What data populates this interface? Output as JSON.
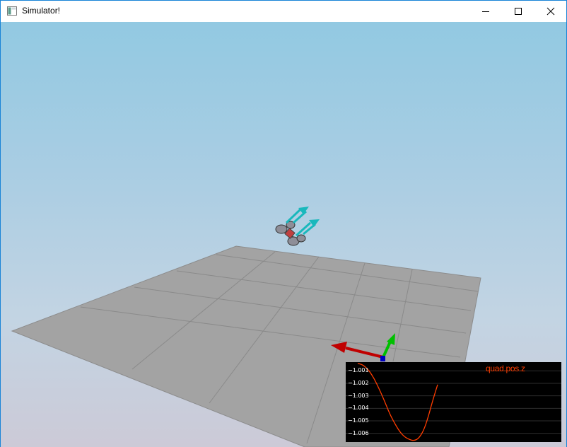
{
  "window": {
    "title": "Simulator!",
    "icons": {
      "app": "window-app-icon",
      "minimize": "minimize-icon",
      "maximize": "maximize-icon",
      "close": "close-icon"
    }
  },
  "scene": {
    "colors": {
      "sky_top": "#92c9e2",
      "sky_bottom": "#cccad7",
      "floor": "#a3a3a3",
      "floor_lines": "#8a8a8a",
      "thrust_arrows": "#19b8bc",
      "axis_x": "#c00000",
      "axis_y": "#00c000",
      "axis_z": "#0000c0"
    }
  },
  "plot": {
    "title": "quad.pos.z",
    "yticks": [
      "-1.001",
      "-1.002",
      "-1.003",
      "-1.004",
      "-1.005",
      "-1.006"
    ],
    "line_color": "#ff3d00",
    "chart_data": {
      "type": "line",
      "title": "quad.pos.z",
      "ylim": [
        -1.0067,
        -1.0003
      ],
      "series": [
        {
          "name": "quad.pos.z",
          "values": [
            -1.0004,
            -1.0005,
            -1.0008,
            -1.0013,
            -1.002,
            -1.0028,
            -1.0037,
            -1.0046,
            -1.0053,
            -1.0059,
            -1.0063,
            -1.0065,
            -1.0066,
            -1.0064,
            -1.0058,
            -1.0047,
            -1.0033,
            -1.0021
          ]
        }
      ]
    }
  }
}
